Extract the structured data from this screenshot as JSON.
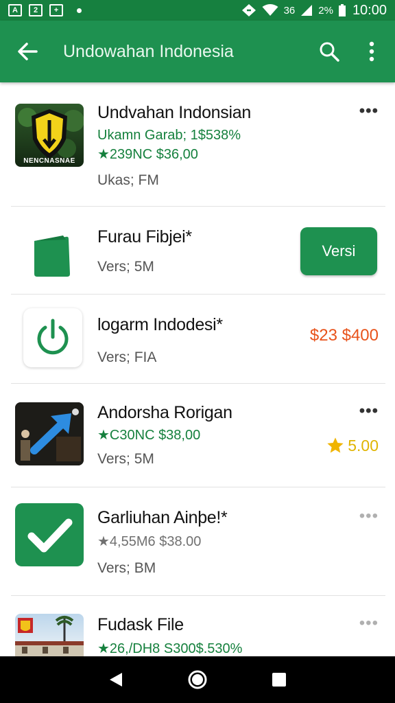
{
  "status_bar": {
    "left_icon_1": "A",
    "left_icon_2": "2",
    "left_icon_3": "+",
    "signal_text": "36",
    "battery_text": "2%",
    "time": "10:00"
  },
  "app_bar": {
    "title": "Undowahan Indonesia",
    "back_icon": "arrow-back-icon",
    "search_icon": "search-icon",
    "more_icon": "more-vert-icon"
  },
  "items": [
    {
      "title": "Undvahan Indonsian",
      "subtitle": "Ukamn Garab; 1$538%",
      "rating_line": "★239NC $36,00",
      "meta": "Ukas; FM",
      "thumb_label": "NENCNASNAE",
      "action": "more"
    },
    {
      "title": "Furau Fibjei*",
      "meta": "Vers; 5M",
      "button_label": "Versi"
    },
    {
      "title": "logarm Indodesi*",
      "meta": "Vers; FIA",
      "price": "$23 $400"
    },
    {
      "title": "Andorsha Rorigan",
      "rating_line": "★C30NC $38,00",
      "meta": "Vers; 5M",
      "rating": "5.00",
      "action": "more"
    },
    {
      "title": "Garliuhan Ainþe!*",
      "rating_line": "★4,55M6 $38.00",
      "meta": "Vers; BM",
      "action": "more"
    },
    {
      "title": "Fudask File",
      "rating_line": "★26,/DH8 S300$.530%",
      "action": "more"
    }
  ],
  "nav_bar": {
    "back": "nav-back-icon",
    "home": "nav-home-icon",
    "recents": "nav-recents-icon"
  },
  "colors": {
    "app_bar": "#1e9150",
    "status_bar": "#16803f",
    "accent_green": "#15803d",
    "price": "#e8531b",
    "star": "#f0b400"
  }
}
